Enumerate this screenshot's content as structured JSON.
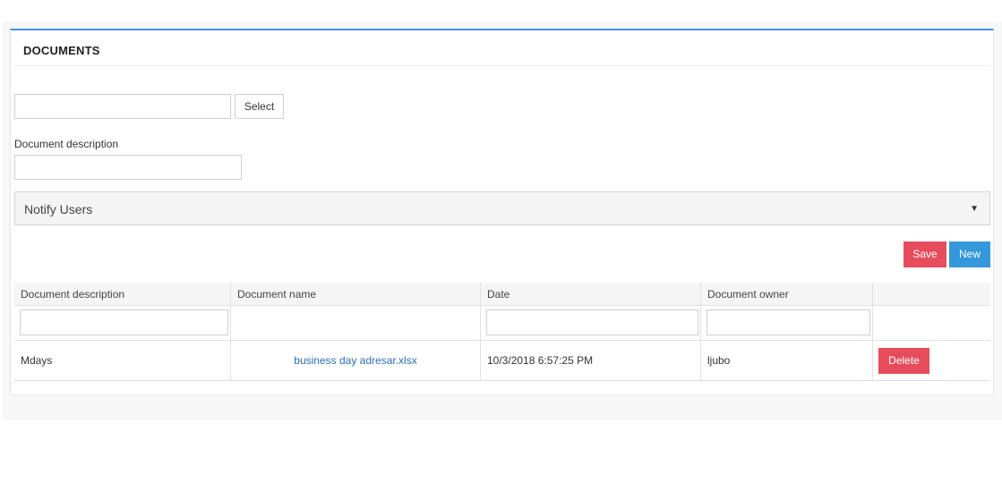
{
  "panel": {
    "title": "DOCUMENTS"
  },
  "upload": {
    "select_label": "Select",
    "file_value": ""
  },
  "description": {
    "label": "Document description",
    "value": ""
  },
  "notify": {
    "label": "Notify Users"
  },
  "actions": {
    "save_label": "Save",
    "new_label": "New"
  },
  "table": {
    "columns": [
      "Document description",
      "Document name",
      "Date",
      "Document owner",
      ""
    ],
    "rows": [
      {
        "description": "Mdays",
        "name": "business day adresar.xlsx",
        "date": "10/3/2018 6:57:25 PM",
        "owner": "ljubo",
        "delete_label": "Delete"
      }
    ]
  },
  "colors": {
    "accent": "#4a90e2",
    "save": "#e74c5c",
    "new": "#3498db",
    "link": "#2a6fb0"
  }
}
